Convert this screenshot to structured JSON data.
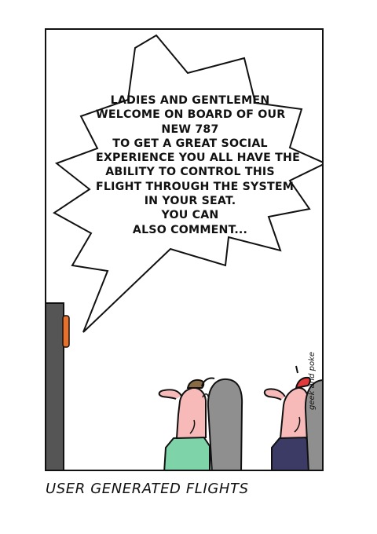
{
  "comic": {
    "speech_lines": [
      "LADIES AND GENTLEMEN",
      "WELCOME ON BOARD OF OUR",
      "NEW 787",
      "TO GET A GREAT SOCIAL",
      "EXPERIENCE YOU ALL HAVE THE",
      "ABILITY TO CONTROL THIS",
      "FLIGHT THROUGH THE SYSTEM",
      "IN YOUR SEAT.",
      "YOU CAN",
      "ALSO COMMENT..."
    ],
    "signature": "geek and poke",
    "caption": "USER GENERATED FLIGHTS"
  },
  "colors": {
    "skin": "#f8b9b9",
    "seat": "#8f8f8f",
    "speaker": "#555555",
    "light": "#e8702a",
    "shirt_left": "#7fd3a8",
    "shirt_right": "#3b3b66",
    "hair_left": "#8a6a45",
    "cap_right": "#e23a3a"
  }
}
